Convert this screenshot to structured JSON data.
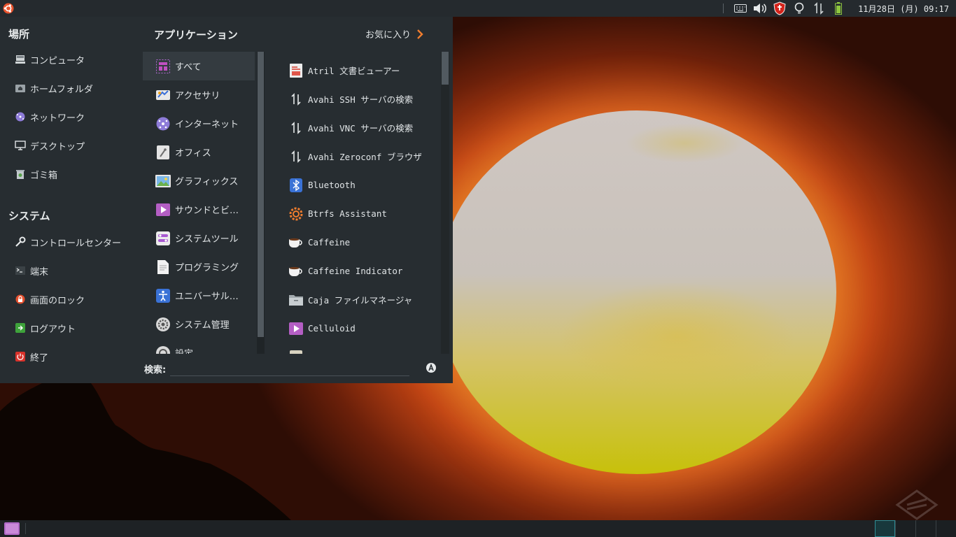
{
  "top_panel": {
    "clock": "11月28日 (月) 09:17",
    "tray_icons": [
      "keyboard-icon",
      "volume-icon",
      "shield-icon",
      "lightbulb-icon",
      "network-icon",
      "battery-icon"
    ]
  },
  "menu": {
    "places_heading": "場所",
    "places": [
      {
        "label": "コンピュータ",
        "icon": "computer-icon"
      },
      {
        "label": "ホームフォルダ",
        "icon": "home-folder-icon"
      },
      {
        "label": "ネットワーク",
        "icon": "network-icon"
      },
      {
        "label": "デスクトップ",
        "icon": "desktop-icon"
      },
      {
        "label": "ゴミ箱",
        "icon": "trash-icon"
      }
    ],
    "system_heading": "システム",
    "system": [
      {
        "label": "コントロールセンター",
        "icon": "wrench-icon"
      },
      {
        "label": "端末",
        "icon": "terminal-icon"
      },
      {
        "label": "画面のロック",
        "icon": "lock-icon"
      },
      {
        "label": "ログアウト",
        "icon": "logout-icon"
      },
      {
        "label": "終了",
        "icon": "power-icon"
      }
    ],
    "apps_heading": "アプリケーション",
    "favorites_label": "お気に入り",
    "categories": [
      {
        "label": "すべて",
        "icon": "all-apps-icon"
      },
      {
        "label": "アクセサリ",
        "icon": "accessories-icon"
      },
      {
        "label": "インターネット",
        "icon": "internet-icon"
      },
      {
        "label": "オフィス",
        "icon": "office-icon"
      },
      {
        "label": "グラフィックス",
        "icon": "graphics-icon"
      },
      {
        "label": "サウンドとビ…",
        "icon": "multimedia-icon"
      },
      {
        "label": "システムツール",
        "icon": "system-tools-icon"
      },
      {
        "label": "プログラミング",
        "icon": "programming-icon"
      },
      {
        "label": "ユニバーサル…",
        "icon": "accessibility-icon"
      },
      {
        "label": "システム管理",
        "icon": "settings-gear-icon"
      },
      {
        "label": "設定",
        "icon": "settings-icon"
      }
    ],
    "apps": [
      {
        "label": "Atril 文書ビューアー",
        "icon": "document-viewer-icon"
      },
      {
        "label": "Avahi SSH サーバの検索",
        "icon": "avahi-icon"
      },
      {
        "label": "Avahi VNC サーバの検索",
        "icon": "avahi-icon"
      },
      {
        "label": "Avahi Zeroconf ブラウザ",
        "icon": "avahi-icon"
      },
      {
        "label": "Bluetooth",
        "icon": "bluetooth-icon"
      },
      {
        "label": "Btrfs Assistant",
        "icon": "btrfs-icon"
      },
      {
        "label": "Caffeine",
        "icon": "coffee-cup-icon"
      },
      {
        "label": "Caffeine Indicator",
        "icon": "coffee-cup-icon"
      },
      {
        "label": "Caja ファイルマネージャ",
        "icon": "file-manager-icon"
      },
      {
        "label": "Celluloid",
        "icon": "video-player-icon"
      },
      {
        "label": "",
        "icon": "partial-app-icon"
      }
    ],
    "search_label": "検索:",
    "search_value": "",
    "search_placeholder": ""
  },
  "colors": {
    "panel_bg": "#252a2e",
    "menu_bg": "#272d31",
    "accent": "#f07d2e",
    "workspace_active": "#2f8c95"
  }
}
